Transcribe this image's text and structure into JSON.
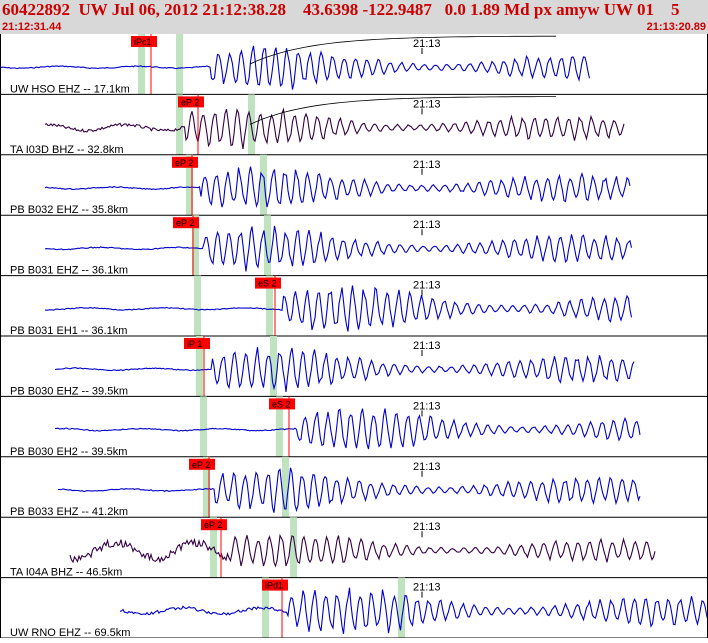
{
  "header": {
    "title": "60422892  UW Jul 06, 2012 21:12:38.28    43.6398 -122.9487   0.0 1.89 Md px amyw UW 01    5",
    "start_time": "21:12:31.44",
    "end_time": "21:13:20.89"
  },
  "colors": {
    "trace": "#0000cc",
    "trace_alt": "#330044",
    "pick": "#ff0000",
    "window": "#bfe3bf",
    "header_bg": "#d8d8d8",
    "header_text": "#cc0000"
  },
  "minute_label": "21:13",
  "channels": [
    {
      "label": "UW HSO EHZ -- 17.1km",
      "pick": "iPc1",
      "color": "trace",
      "curve": true
    },
    {
      "label": "TA I03D BHZ -- 32.8km",
      "pick": "eP 2",
      "color": "trace_alt",
      "curve": true
    },
    {
      "label": "PB B032 EHZ -- 35.8km",
      "pick": "eP 2",
      "color": "trace",
      "curve": false
    },
    {
      "label": "PB B031 EHZ -- 36.1km",
      "pick": "eP 2",
      "color": "trace",
      "curve": false
    },
    {
      "label": "PB B031 EH1 -- 36.1km",
      "pick": "eS 2",
      "color": "trace",
      "curve": false
    },
    {
      "label": "PB B030 EHZ -- 39.5km",
      "pick": "iP 1",
      "color": "trace",
      "curve": false
    },
    {
      "label": "PB B030 EH2 -- 39.5km",
      "pick": "eS 2",
      "color": "trace",
      "curve": false
    },
    {
      "label": "PB B033 EHZ -- 41.2km",
      "pick": "eP 2",
      "color": "trace",
      "curve": false
    },
    {
      "label": "TA I04A BHZ -- 46.5km",
      "pick": "eP 2",
      "color": "trace_alt",
      "curve": true
    },
    {
      "label": "UW RNO EHZ -- 69.5km",
      "pick": "iPd1",
      "color": "trace",
      "curve": true
    }
  ]
}
